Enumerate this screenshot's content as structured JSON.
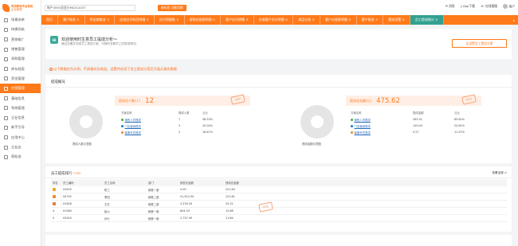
{
  "brand": {
    "name_line1": "时尚教育平台系统",
    "name_line2": "后台管理"
  },
  "sidebar": {
    "items": [
      {
        "label": "场景选单",
        "icon": "home-icon"
      },
      {
        "label": "快捷导航",
        "icon": "grid-icon"
      },
      {
        "label": "营销推广",
        "icon": "megaphone-icon"
      },
      {
        "label": "销售管理",
        "icon": "cart-icon"
      },
      {
        "label": "采购管理",
        "icon": "bag-icon"
      },
      {
        "label": "库存档案",
        "icon": "box-icon"
      },
      {
        "label": "资金管理",
        "icon": "wallet-icon"
      },
      {
        "label": "经营管理",
        "icon": "chart-icon",
        "active": true
      },
      {
        "label": "基础信息",
        "icon": "list-icon"
      },
      {
        "label": "系统管理",
        "icon": "gear-icon"
      },
      {
        "label": "企业信息",
        "icon": "building-icon"
      },
      {
        "label": "新手引导",
        "icon": "compass-icon"
      },
      {
        "label": "应用中心",
        "icon": "apps-icon"
      },
      {
        "label": "企业店",
        "icon": "store-icon"
      },
      {
        "label": "帮助说",
        "icon": "help-icon"
      }
    ]
  },
  "topbar": {
    "tenant": "账户4555总会计ML012037",
    "tenant_button": "新标签  功能切换",
    "mail": "消息",
    "app": "App下载",
    "chat": "在线客服",
    "user": "用户"
  },
  "tabs": [
    {
      "label": "首页"
    },
    {
      "label": "客户账务  ×"
    },
    {
      "label": "供应商账务  ×"
    },
    {
      "label": "应收应付科目明细  ×"
    },
    {
      "label": "应付明细账  ×"
    },
    {
      "label": "采购应收款明细  ×"
    },
    {
      "label": "客户应付明细  ×"
    },
    {
      "label": "应收客户应付明细  ×"
    },
    {
      "label": "商品分析  ×"
    },
    {
      "label": "客户应收款明细  ×"
    },
    {
      "label": "客户账务  ×"
    },
    {
      "label": "提成设置  ×"
    },
    {
      "label": "员工提成统计  ×",
      "active": true
    }
  ],
  "banner": {
    "icon_text": "Hi",
    "title": "欢迎使用时生意员工提成分析～",
    "subtitle": "通过设置并完成员工提成方案，可随时查看员工的提成情况。",
    "button": "去设置员工提成方案"
  },
  "warning": "以下数据仅为示例，不具备实际效益。设置并启用了员工提成方案后可展示真实数据",
  "overview": {
    "title": "提成概况",
    "people": {
      "label": "提成总人数(人)",
      "value": "12",
      "donut_label": "提成人数示意图",
      "stamp": "样例",
      "head": [
        "方案名称",
        "提成人数",
        "占比"
      ],
      "rows": [
        {
          "name": "销售人员提成",
          "count": "7",
          "ratio": "58.33%",
          "color": "#3bb143"
        },
        {
          "name": "门店营销提成",
          "count": "3",
          "ratio": "25.00%",
          "color": "#1a7fd1"
        },
        {
          "name": "客服专员提成",
          "count": "2",
          "ratio": "16.67%",
          "color": "#f08a24"
        }
      ]
    },
    "amount": {
      "label": "提成总金额(元)",
      "value": "475.62",
      "donut_label": "提成金额示意图",
      "stamp": "样例",
      "head": [
        "方案名称",
        "提成金额",
        "占比"
      ],
      "rows": [
        {
          "name": "销售人员提成",
          "count": "345.31",
          "ratio": "65.62%",
          "color": "#3bb143"
        },
        {
          "name": "门店营销提成",
          "count": "120.04",
          "ratio": "22.81%",
          "color": "#1a7fd1"
        },
        {
          "name": "客服专员提成",
          "count": "9.27",
          "ratio": "11.57%",
          "color": "#f08a24"
        }
      ]
    }
  },
  "ranking": {
    "title": "员工提成排行",
    "subtitle": "TOP5",
    "more": "查看全部 >",
    "stamp": "样例",
    "head": [
      "排名",
      "员工编码",
      "员工名称",
      "部门",
      "销售总金额",
      "提成总金额"
    ],
    "rows": [
      {
        "rank": "1",
        "code": "03455",
        "name": "陈三",
        "dept": "销售一部",
        "sales": "5.09",
        "comm": "221.83",
        "medal": "#f5a623"
      },
      {
        "rank": "2",
        "code": "04792",
        "name": "李四",
        "dept": "销售二部",
        "sales": "51,912.00",
        "comm": "222.81",
        "medal": "#f08a24"
      },
      {
        "rank": "3",
        "code": "01626",
        "name": "王五",
        "dept": "销售二部",
        "sales": "2,378.34",
        "comm": "25.31",
        "medal": "#e57a3e"
      },
      {
        "rank": "4",
        "code": "01580",
        "name": "赵六",
        "dept": "销售一部",
        "sales": "644.33",
        "comm": "12.88"
      },
      {
        "rank": "5",
        "code": "03343",
        "name": "孙七",
        "dept": "销售一部",
        "sales": "2,737.09",
        "comm": "11.84"
      }
    ]
  }
}
